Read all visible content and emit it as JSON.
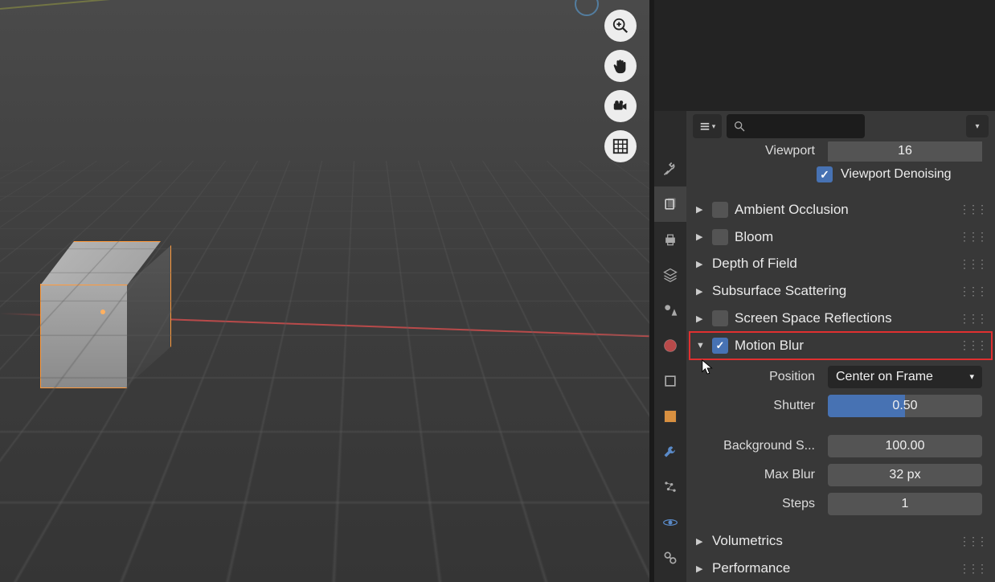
{
  "viewport": {
    "tools": [
      "zoom",
      "pan",
      "camera",
      "grid"
    ]
  },
  "properties": {
    "search_placeholder": "",
    "viewport_row": {
      "label": "Viewport",
      "value": "16"
    },
    "viewport_denoising": {
      "label": "Viewport Denoising",
      "checked": true
    },
    "sections": {
      "ambient_occlusion": {
        "label": "Ambient Occlusion",
        "checked": false,
        "expanded": false
      },
      "bloom": {
        "label": "Bloom",
        "checked": false,
        "expanded": false
      },
      "depth_of_field": {
        "label": "Depth of Field",
        "expanded": false
      },
      "subsurface": {
        "label": "Subsurface Scattering",
        "expanded": false
      },
      "ssr": {
        "label": "Screen Space Reflections",
        "checked": false,
        "expanded": false
      },
      "motion_blur": {
        "label": "Motion Blur",
        "checked": true,
        "expanded": true
      },
      "volumetrics": {
        "label": "Volumetrics",
        "expanded": false
      },
      "performance": {
        "label": "Performance",
        "expanded": false
      }
    },
    "motion_blur": {
      "position": {
        "label": "Position",
        "value": "Center on Frame"
      },
      "shutter": {
        "label": "Shutter",
        "value": "0.50",
        "fill_pct": 50
      },
      "background_separation": {
        "label": "Background S...",
        "value": "100.00"
      },
      "max_blur": {
        "label": "Max Blur",
        "value": "32 px"
      },
      "steps": {
        "label": "Steps",
        "value": "1"
      }
    }
  }
}
